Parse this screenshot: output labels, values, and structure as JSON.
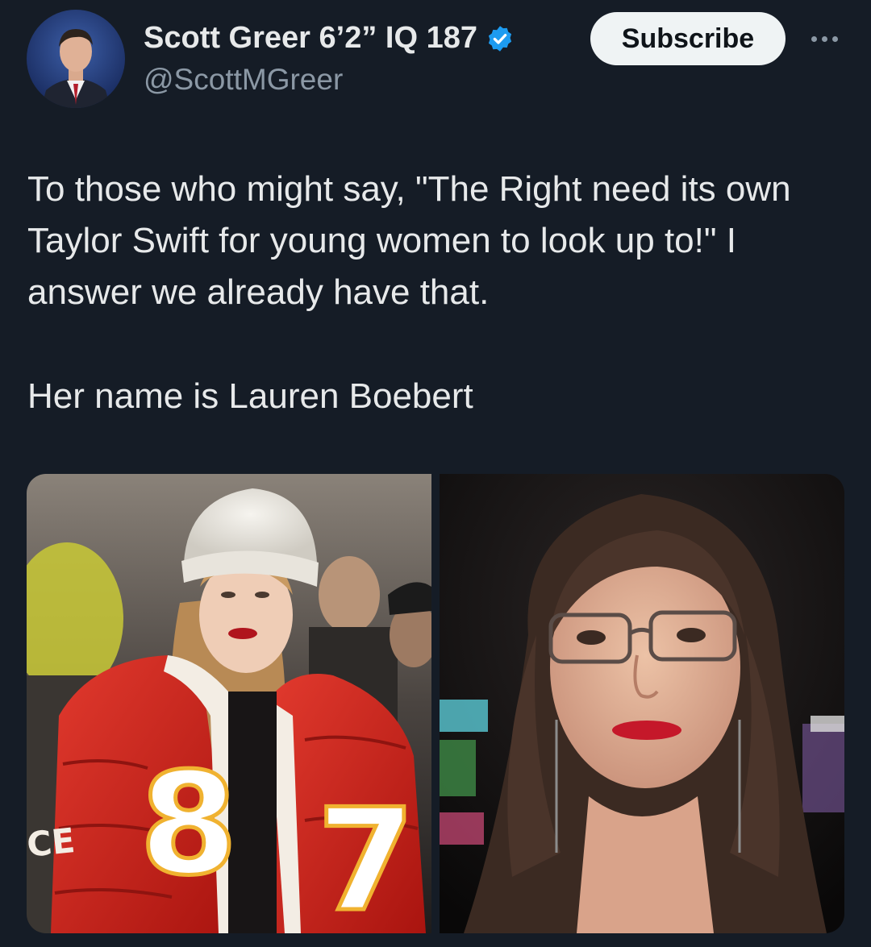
{
  "author": {
    "display_name": "Scott Greer 6’2” IQ 187",
    "handle": "@ScottMGreer",
    "verified": true,
    "accent_color": "#1d9bf0"
  },
  "actions": {
    "subscribe_label": "Subscribe",
    "more_icon": "more-horizontal-icon"
  },
  "tweet": {
    "text": "To those who might say, \"The Right need its own Taylor Swift for young women to look up to!\" I answer we already have that.",
    "text_2": "Her name is Lauren Boebert"
  },
  "media": {
    "photo_1": {
      "jacket_number": "87",
      "sleeve_text": "CE"
    }
  },
  "colors": {
    "background": "#151c26",
    "text": "#e7e9ea",
    "secondary_text": "#8b98a5",
    "button_bg": "#eff3f4"
  }
}
